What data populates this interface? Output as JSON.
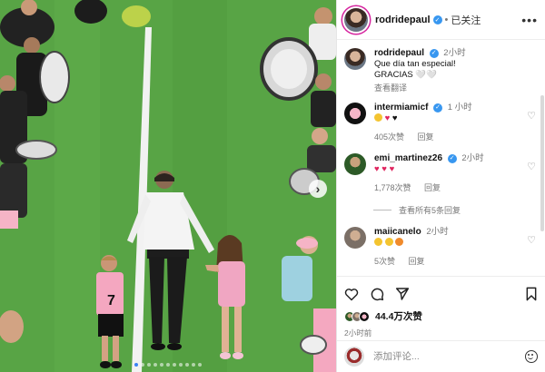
{
  "post": {
    "author": "rodridepaul",
    "follow_state": "已关注",
    "caption_line1": "Que día tan especial!",
    "caption_line2": "GRACIAS 🤍🤍",
    "caption_time": "2小时",
    "translate": "查看翻译",
    "likes": "44.4万次赞",
    "time": "2小时前",
    "carousel_count": 11,
    "carousel_active": 0
  },
  "comments": [
    {
      "user": "intermiamicf",
      "verified": true,
      "time": "1 小时",
      "likes": "405次赞",
      "reply": "回复"
    },
    {
      "user": "emi_martinez26",
      "verified": true,
      "time": "2小时",
      "likes": "1,778次赞",
      "reply": "回复",
      "view_replies": "查看所有5条回复"
    },
    {
      "user": "maiicanelo",
      "verified": false,
      "time": "2小时",
      "likes": "5次赞",
      "reply": "回复"
    }
  ],
  "add_comment": {
    "placeholder": "添加评论..."
  },
  "icons": [
    "more-icon",
    "verified-icon",
    "heart-icon",
    "comment-icon",
    "share-icon",
    "bookmark-icon",
    "emoji-icon",
    "next-arrow-icon"
  ],
  "colors": {
    "verified": "#3897f0",
    "heart": "#e0245e",
    "story_ring": "#d6249f",
    "carousel_active": "#3b82f6"
  }
}
